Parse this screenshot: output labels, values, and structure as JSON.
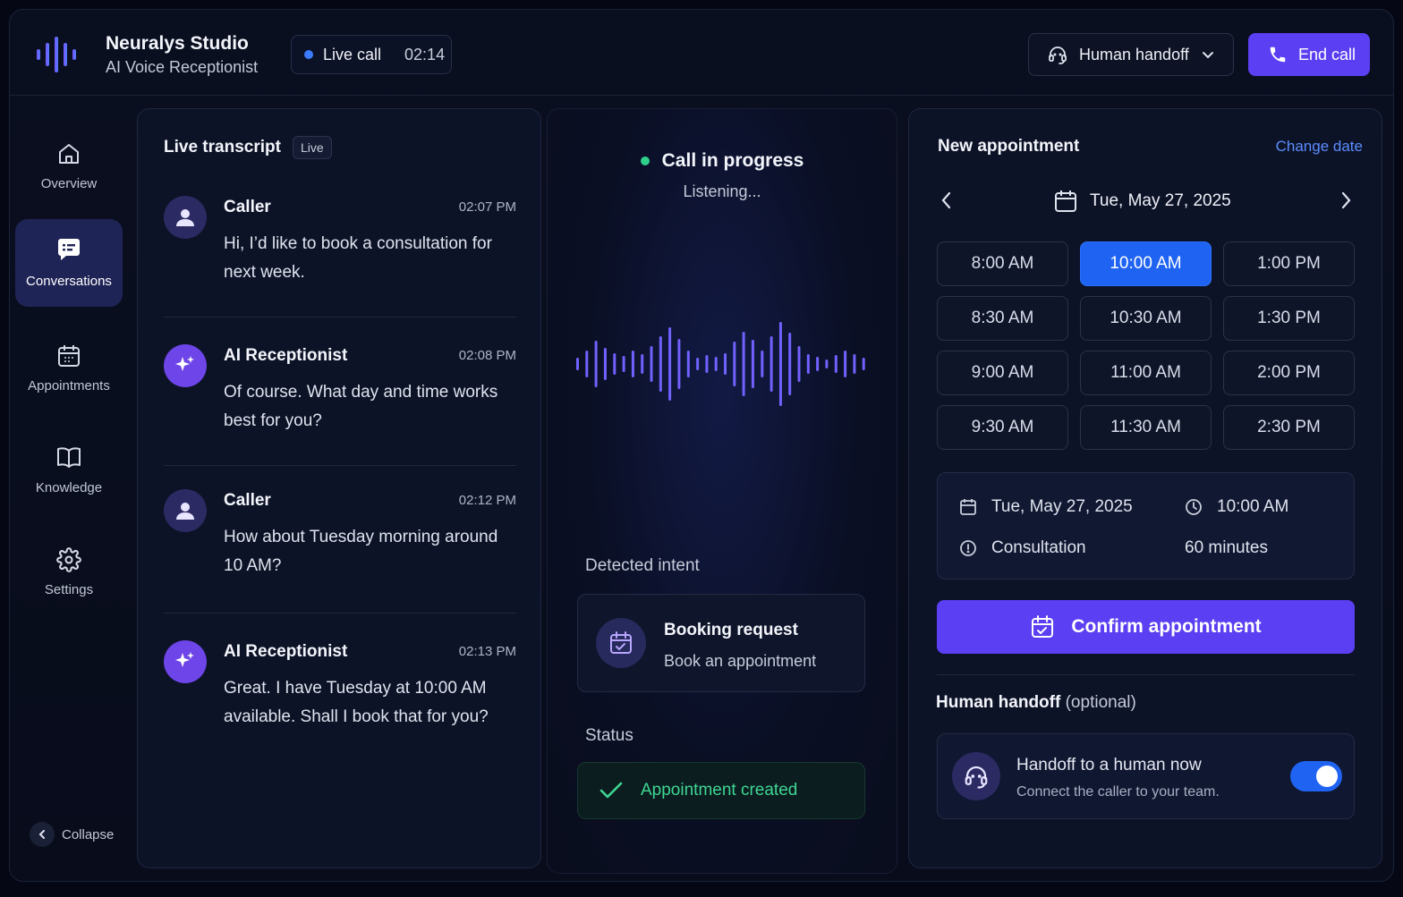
{
  "header": {
    "brand_title": "Neuralys Studio",
    "brand_subtitle": "AI Voice Receptionist",
    "live_label": "Live call",
    "live_timer": "02:14",
    "handoff_label": "Human handoff",
    "end_call_label": "End call"
  },
  "sidebar": {
    "items": [
      {
        "label": "Overview",
        "icon": "home-icon"
      },
      {
        "label": "Conversations",
        "icon": "chat-icon",
        "active": true
      },
      {
        "label": "Appointments",
        "icon": "calendar-icon"
      },
      {
        "label": "Knowledge",
        "icon": "book-icon"
      },
      {
        "label": "Settings",
        "icon": "gear-icon"
      }
    ],
    "collapse_label": "Collapse"
  },
  "transcript": {
    "title": "Live transcript",
    "badge": "Live",
    "messages": [
      {
        "speaker": "Caller",
        "time": "02:07 PM",
        "text": "Hi, I’d like to book a consultation for next week."
      },
      {
        "speaker": "AI Receptionist",
        "time": "02:08 PM",
        "text": "Of course. What day and time works best for you?"
      },
      {
        "speaker": "Caller",
        "time": "02:12 PM",
        "text": "How about Tuesday morning around 10 AM?"
      },
      {
        "speaker": "AI Receptionist",
        "time": "02:13 PM",
        "text": "Great. I have Tuesday at 10:00 AM available. Shall I book that for you?"
      }
    ]
  },
  "call": {
    "status": "Call in progress",
    "substatus": "Listening...",
    "intent_label": "Detected intent",
    "intent_title": "Booking request",
    "intent_sub": "Book an appointment",
    "status_label": "Status",
    "status_value": "Appointment created",
    "colors": {
      "live": "#2fcf8c",
      "success": "#3fd694"
    }
  },
  "booking": {
    "title": "New appointment",
    "change_date": "Change date",
    "date": "Tue, May 27, 2025",
    "slots": [
      "8:00 AM",
      "10:00 AM",
      "1:00 PM",
      "8:30 AM",
      "10:30 AM",
      "1:30 PM",
      "9:00 AM",
      "11:00 AM",
      "2:00 PM",
      "9:30 AM",
      "11:30 AM",
      "2:30 PM"
    ],
    "selected_slot": "10:00 AM",
    "summary": {
      "date": "Tue, May 27, 2025",
      "time": "10:00 AM",
      "type": "Consultation",
      "duration": "60 minutes"
    },
    "confirm_label": "Confirm appointment",
    "handoff_title": "Human handoff",
    "handoff_optional": "(optional)",
    "handoff_card_title": "Handoff to a human now",
    "handoff_card_sub": "Connect the caller to your team.",
    "handoff_enabled": true,
    "accent": "#5b3ff2",
    "selected_color": "#1f63f2"
  }
}
